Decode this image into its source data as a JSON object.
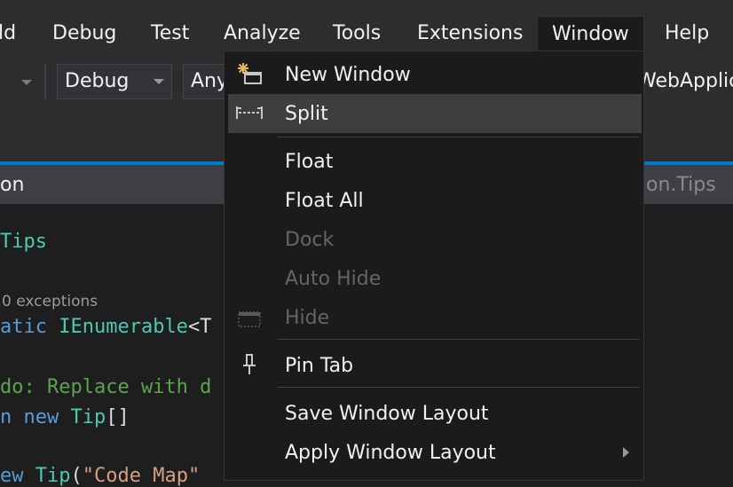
{
  "menubar": {
    "items": [
      "ld",
      "Debug",
      "Test",
      "Analyze",
      "Tools",
      "Extensions",
      "Window",
      "Help"
    ],
    "open_item": "Window"
  },
  "toolbar": {
    "config_combo": "Debug",
    "platform_combo": "Any",
    "startup_project_text": "WebApplica"
  },
  "tabs": {
    "left_tab_text": "on",
    "right_tab_text": "on.Tips"
  },
  "editor": {
    "line1": "Tips",
    "codelens": "0 exceptions",
    "line2_a": "atic ",
    "line2_b": "IEnumerable",
    "line2_c": "<T",
    "line3": "do: Replace with d",
    "line4_a": "n ",
    "line4_b": "new ",
    "line4_c": "Tip",
    "line4_d": "[]",
    "line5_a": "ew ",
    "line5_b": "Tip",
    "line5_c": "(",
    "line5_d": "\"Code Map\""
  },
  "window_menu": {
    "items": [
      {
        "label": "New Window",
        "icon": "new-window-icon",
        "enabled": true
      },
      {
        "label": "Split",
        "icon": "split-icon",
        "enabled": true,
        "highlighted": true
      },
      {
        "label": "Float",
        "enabled": true
      },
      {
        "label": "Float All",
        "enabled": true
      },
      {
        "label": "Dock",
        "enabled": false
      },
      {
        "label": "Auto Hide",
        "enabled": false
      },
      {
        "label": "Hide",
        "icon": "hide-icon",
        "enabled": false
      },
      {
        "label": "Pin Tab",
        "icon": "pin-icon",
        "enabled": true
      },
      {
        "label": "Save Window Layout",
        "enabled": true
      },
      {
        "label": "Apply Window Layout",
        "enabled": true,
        "submenu": true
      }
    ]
  },
  "colors": {
    "accent": "#007acc",
    "menu_bg": "#1b1b1c",
    "chrome_bg": "#2d2d30",
    "highlight": "#3e3e40"
  }
}
